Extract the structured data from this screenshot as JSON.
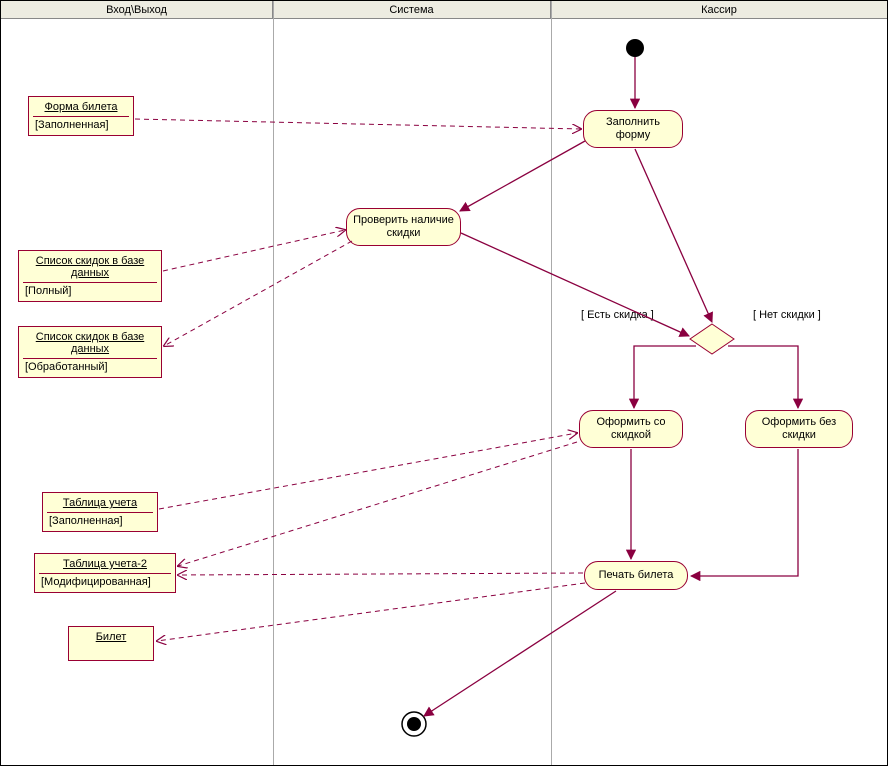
{
  "lanes": {
    "io": "Вход\\Выход",
    "system": "Система",
    "cashier": "Кассир"
  },
  "objects": {
    "ticketForm": {
      "name": "Форма билета",
      "state": "[Заполненная]"
    },
    "discountListFull": {
      "name": "Список скидок в базе данных",
      "state": "[Полный]"
    },
    "discountListProcessed": {
      "name": "Список скидок в базе данных",
      "state": "[Обработанный]"
    },
    "accountTable": {
      "name": "Таблица учета",
      "state": "[Заполненная]"
    },
    "accountTable2": {
      "name": "Таблица учета-2",
      "state": "[Модифицированная]"
    },
    "ticket": {
      "name": "Билет"
    }
  },
  "activities": {
    "fillForm": "Заполнить форму",
    "checkDiscount": "Проверить наличие скидки",
    "withDiscount": "Оформить со скидкой",
    "withoutDiscount": "Оформить без скидки",
    "printTicket": "Печать билета"
  },
  "guards": {
    "hasDiscount": "[ Есть скидка ]",
    "noDiscount": "[ Нет скидки ]"
  }
}
